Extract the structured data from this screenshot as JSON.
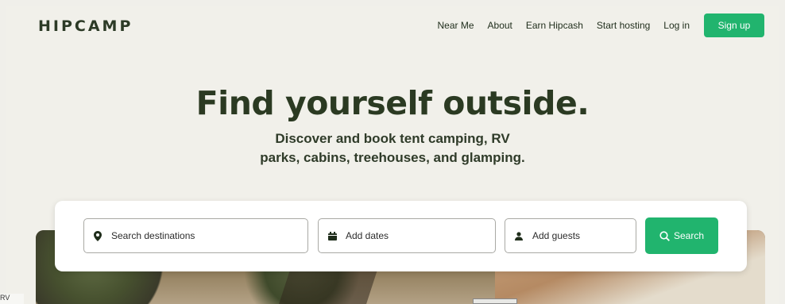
{
  "brand": {
    "logo_text": "HIPCAMP"
  },
  "nav": {
    "items": [
      "Near Me",
      "About",
      "Earn Hipcash",
      "Start hosting",
      "Log in"
    ],
    "signup_label": "Sign up"
  },
  "hero": {
    "title": "Find yourself outside.",
    "subtitle_line1": "Discover and book tent camping, RV",
    "subtitle_line2": "parks, cabins, treehouses, and glamping."
  },
  "search": {
    "destination_placeholder": "Search destinations",
    "dates_placeholder": "Add dates",
    "guests_placeholder": "Add guests",
    "button_label": "Search"
  },
  "icons": {
    "destination": "map-pin-icon",
    "dates": "calendar-icon",
    "guests": "person-icon",
    "search": "search-icon"
  },
  "colors": {
    "accent": "#21b46e",
    "background": "#f1f0ea",
    "heading": "#2b3a22"
  },
  "footer_fragment": {
    "text": "RV"
  }
}
